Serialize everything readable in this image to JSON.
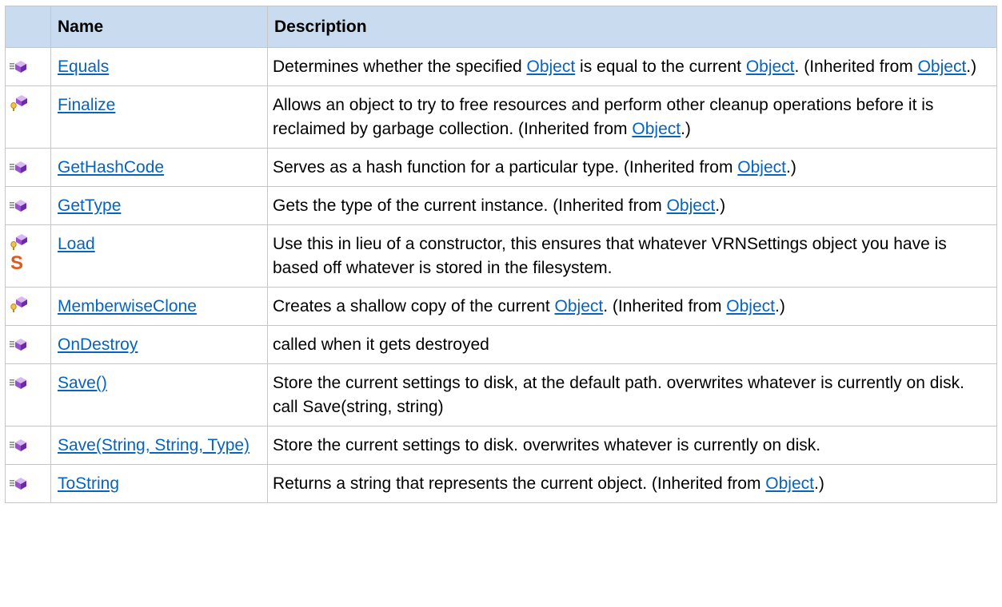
{
  "header": {
    "name": "Name",
    "description": "Description"
  },
  "colors": {
    "header_bg": "#c9dcef",
    "link": "#0563c1",
    "border": "#c6c6c6",
    "static_icon": "#e0581c"
  },
  "rows": [
    {
      "icon": "public-method-icon",
      "name": "Equals",
      "desc": [
        {
          "t": "Determines whether the specified "
        },
        {
          "t": "Object",
          "link": true
        },
        {
          "t": " is equal to the current "
        },
        {
          "t": "Object",
          "link": true
        },
        {
          "t": ". (Inherited from "
        },
        {
          "t": "Object",
          "link": true
        },
        {
          "t": ".)"
        }
      ]
    },
    {
      "icon": "protected-method-icon",
      "name": "Finalize",
      "desc": [
        {
          "t": "Allows an object to try to free resources and perform other cleanup operations before it is reclaimed by garbage collection. (Inherited from "
        },
        {
          "t": "Object",
          "link": true
        },
        {
          "t": ".)"
        }
      ]
    },
    {
      "icon": "public-method-icon",
      "name": "GetHashCode",
      "desc": [
        {
          "t": "Serves as a hash function for a particular type. (Inherited from "
        },
        {
          "t": "Object",
          "link": true
        },
        {
          "t": ".)"
        }
      ]
    },
    {
      "icon": "public-method-icon",
      "name": "GetType",
      "desc": [
        {
          "t": "Gets the type of the current instance. (Inherited from "
        },
        {
          "t": "Object",
          "link": true
        },
        {
          "t": ".)"
        }
      ]
    },
    {
      "icon": "protected-method-icon",
      "static": "S",
      "name": "Load",
      "desc": [
        {
          "t": "Use this in lieu of a constructor, this ensures that whatever VRNSettings object you have is based off whatever is stored in the filesystem."
        }
      ]
    },
    {
      "icon": "protected-method-icon",
      "name": "MemberwiseClone",
      "desc": [
        {
          "t": "Creates a shallow copy of the current "
        },
        {
          "t": "Object",
          "link": true
        },
        {
          "t": ". (Inherited from "
        },
        {
          "t": "Object",
          "link": true
        },
        {
          "t": ".)"
        }
      ]
    },
    {
      "icon": "public-method-icon",
      "name": "OnDestroy",
      "desc": [
        {
          "t": "called when it gets destroyed"
        }
      ]
    },
    {
      "icon": "public-method-icon",
      "name": "Save()",
      "desc": [
        {
          "t": "Store the current settings to disk, at the default path. overwrites whatever is currently on disk. call Save(string, string)"
        }
      ]
    },
    {
      "icon": "public-method-icon",
      "name": "Save(String, String, Type)",
      "desc": [
        {
          "t": "Store the current settings to disk. overwrites whatever is currently on disk."
        }
      ]
    },
    {
      "icon": "public-method-icon",
      "name": "ToString",
      "desc": [
        {
          "t": "Returns a string that represents the current object. (Inherited from "
        },
        {
          "t": "Object",
          "link": true
        },
        {
          "t": ".)"
        }
      ]
    }
  ]
}
